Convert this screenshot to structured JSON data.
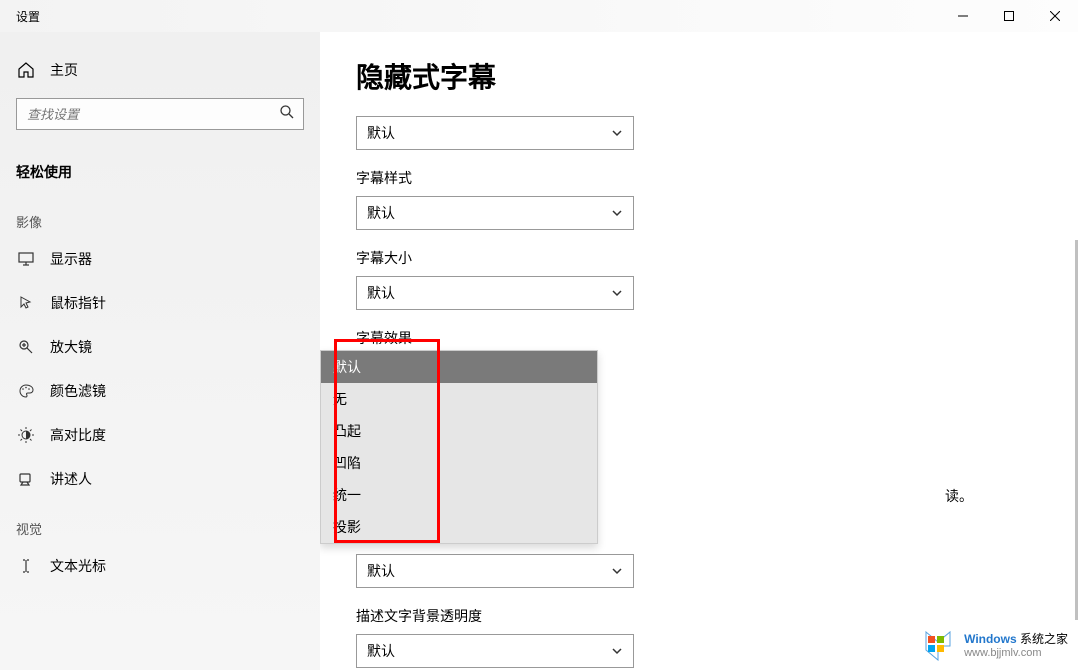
{
  "titlebar": {
    "title": "设置"
  },
  "sidebar": {
    "home": "主页",
    "search_placeholder": "查找设置",
    "section": "轻松使用",
    "group_vision": "影像",
    "group_audio": "视觉",
    "items": [
      {
        "label": "显示器"
      },
      {
        "label": "鼠标指针"
      },
      {
        "label": "放大镜"
      },
      {
        "label": "颜色滤镜"
      },
      {
        "label": "高对比度"
      },
      {
        "label": "讲述人"
      },
      {
        "label": "文本光标"
      }
    ]
  },
  "main": {
    "heading": "隐藏式字幕",
    "select_default": "默认",
    "labels": {
      "style": "字幕样式",
      "size": "字幕大小",
      "effect": "字幕效果",
      "bg_opacity": "描述文字背景透明度"
    },
    "hint_fragment": "读。",
    "dropdown_options": [
      "默认",
      "无",
      "凸起",
      "凹陷",
      "统一",
      "投影"
    ]
  },
  "watermark": {
    "brand": "Windows",
    "suffix": " 系统之家",
    "url": "www.bjjmlv.com"
  }
}
